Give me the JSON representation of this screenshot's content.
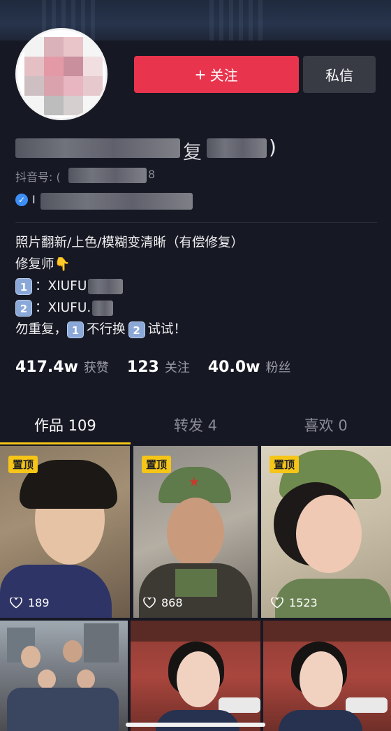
{
  "header": {
    "follow_label": "关注",
    "message_label": "私信"
  },
  "profile": {
    "nickname_visible": "复",
    "nickname_tail": ")",
    "id_label": "抖音号: (",
    "id_tail": "8",
    "verified_text": "I"
  },
  "bio": {
    "lines": [
      "照片翻新/上色/模糊变清晰（有偿修复）",
      "修复师👇",
      "XIUFU",
      "XIUFU.",
      "勿重复，",
      "不行换",
      "试试！"
    ],
    "key1": "1",
    "key2": "2",
    "sep": "："
  },
  "stats": [
    {
      "value": "417.4w",
      "label": "获赞"
    },
    {
      "value": "123",
      "label": "关注"
    },
    {
      "value": "40.0w",
      "label": "粉丝"
    }
  ],
  "tabs": [
    {
      "label": "作品 109",
      "active": true
    },
    {
      "label": "转发 4",
      "active": false
    },
    {
      "label": "喜欢 0",
      "active": false
    }
  ],
  "videos": [
    {
      "pinned": "置顶",
      "likes": "189"
    },
    {
      "pinned": "置顶",
      "likes": "868"
    },
    {
      "pinned": "置顶",
      "likes": "1523"
    },
    {
      "pinned": "",
      "likes": ""
    },
    {
      "pinned": "",
      "likes": ""
    },
    {
      "pinned": "",
      "likes": ""
    }
  ],
  "colors": {
    "background": "#161823",
    "follow_button": "#e8344d",
    "message_button": "#393b44",
    "tab_indicator": "#f5c518",
    "pin_badge": "#f5c518"
  }
}
